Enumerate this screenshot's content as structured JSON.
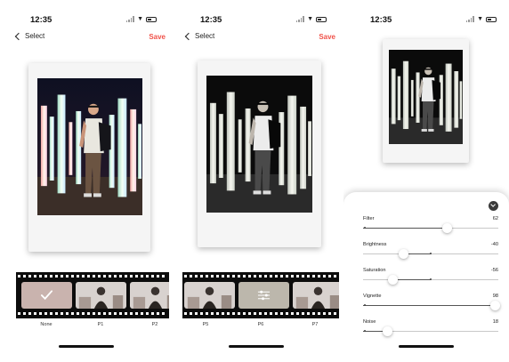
{
  "status": {
    "time": "12:35"
  },
  "nav": {
    "back_label": "Select",
    "save_label": "Save"
  },
  "colors": {
    "accent": "#f0524a"
  },
  "icons": {
    "back": "chevron-left-icon",
    "selected": "checkmark-icon",
    "adjust": "sliders-icon",
    "collapse": "chevron-down-icon"
  },
  "screen1": {
    "film_labels": [
      "None",
      "P1",
      "P2"
    ],
    "selected_filter": "None"
  },
  "screen2": {
    "film_labels": [
      "P5",
      "P6",
      "P7"
    ],
    "selected_filter": "P6"
  },
  "screen3": {
    "adjustments": [
      {
        "label": "Filter",
        "value": "62",
        "level": 62,
        "min": 0,
        "max": 100
      },
      {
        "label": "Brightness",
        "value": "-40",
        "level": -40,
        "min": -100,
        "max": 100
      },
      {
        "label": "Saturation",
        "value": "-56",
        "level": -56,
        "min": -100,
        "max": 100
      },
      {
        "label": "Vignette",
        "value": "98",
        "level": 98,
        "min": 0,
        "max": 100
      },
      {
        "label": "Noise",
        "value": "18",
        "level": 18,
        "min": 0,
        "max": 100
      }
    ]
  }
}
